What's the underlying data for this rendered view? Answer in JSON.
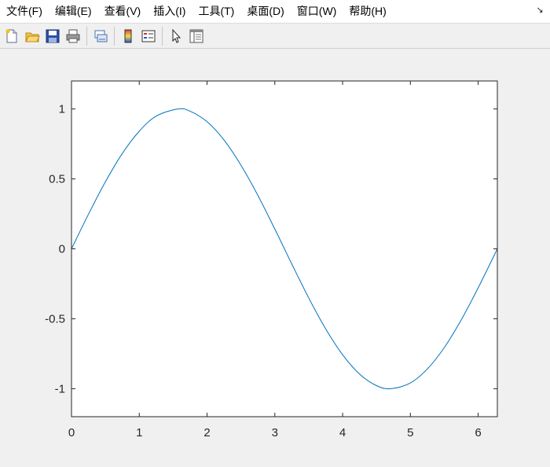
{
  "menubar": {
    "items": [
      "文件(F)",
      "编辑(E)",
      "查看(V)",
      "插入(I)",
      "工具(T)",
      "桌面(D)",
      "窗口(W)",
      "帮助(H)"
    ]
  },
  "toolbar": {
    "buttons": [
      {
        "icon": "new-figure-icon"
      },
      {
        "icon": "open-file-icon"
      },
      {
        "icon": "save-icon"
      },
      {
        "icon": "print-icon"
      },
      {
        "icon": "link-plot-icon"
      },
      {
        "icon": "colorbar-icon"
      },
      {
        "icon": "legend-icon"
      },
      {
        "icon": "edit-plot-arrow-icon"
      },
      {
        "icon": "property-inspector-icon"
      }
    ]
  },
  "chart_data": {
    "type": "line",
    "title": "",
    "xlabel": "",
    "ylabel": "",
    "xlim": [
      0,
      6.2832
    ],
    "ylim": [
      -1.2,
      1.2
    ],
    "xticks": [
      0,
      1,
      2,
      3,
      4,
      5,
      6
    ],
    "yticks": [
      1,
      0.5,
      0,
      -0.5,
      -1
    ],
    "xtick_labels": [
      "0",
      "1",
      "2",
      "3",
      "4",
      "5",
      "6"
    ],
    "ytick_labels": [
      "1",
      "0.5",
      "0",
      "-0.5",
      "-1"
    ],
    "grid": false,
    "series": [
      {
        "color": "#0072BD",
        "x": [
          0,
          0.25,
          0.5,
          0.75,
          1.0,
          1.25,
          1.5708,
          1.75,
          2.0,
          2.25,
          2.5,
          2.75,
          3.0,
          3.1416,
          3.25,
          3.5,
          3.75,
          4.0,
          4.25,
          4.5,
          4.7124,
          5.0,
          5.25,
          5.5,
          5.75,
          6.0,
          6.2832
        ],
        "y": [
          0,
          0.247,
          0.479,
          0.682,
          0.841,
          0.949,
          1.0,
          0.984,
          0.909,
          0.778,
          0.598,
          0.382,
          0.141,
          0,
          -0.108,
          -0.351,
          -0.572,
          -0.757,
          -0.895,
          -0.978,
          -1.0,
          -0.959,
          -0.859,
          -0.706,
          -0.508,
          -0.279,
          0
        ]
      }
    ]
  }
}
